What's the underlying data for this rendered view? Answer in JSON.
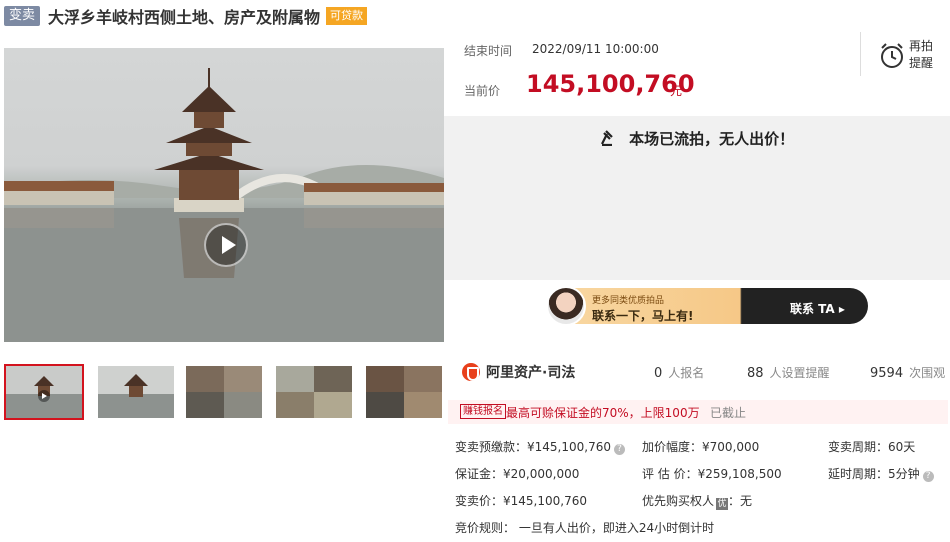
{
  "title": {
    "tag": "变卖",
    "text": "大浮乡羊岐村西侧土地、房产及附属物",
    "loan_tag": "可贷款"
  },
  "auction": {
    "end_label": "结束时间",
    "end_time": "2022/09/11 10:00:00",
    "price_label": "当前价",
    "price": "145,100,760",
    "price_unit": "元",
    "remind_label": "再拍提醒",
    "status": "本场已流拍，无人出价！"
  },
  "contact": {
    "line1": "更多同类优质拍品",
    "line2": "联系一下，马上有!",
    "button": "联系 TA"
  },
  "stats": {
    "brand": "阿里资产·司法",
    "signups": "0",
    "signups_unit": "人报名",
    "reminders": "88",
    "reminders_unit": "人设置提醒",
    "views": "9594",
    "views_unit": "次围观"
  },
  "deposit": {
    "tag": "赚钱报名",
    "text": "最高可赊保证金的70%，上限100万",
    "status": "已截止"
  },
  "details": {
    "presale_price": "变卖预缴款：¥145,100,760",
    "increment": "加价幅度：¥700,000",
    "period": "变卖周期：60天",
    "deposit": "保证金：¥20,000,000",
    "appraisal": "评 估 价：¥259,108,500",
    "delay": "延时周期：5分钟",
    "sale_price": "变卖价：¥145,100,760",
    "priority": "优先购买权人",
    "priority_icon": "优",
    "priority_value": "：无",
    "rule": "竞价规则：  一旦有人出价，即进入24小时倒计时"
  }
}
